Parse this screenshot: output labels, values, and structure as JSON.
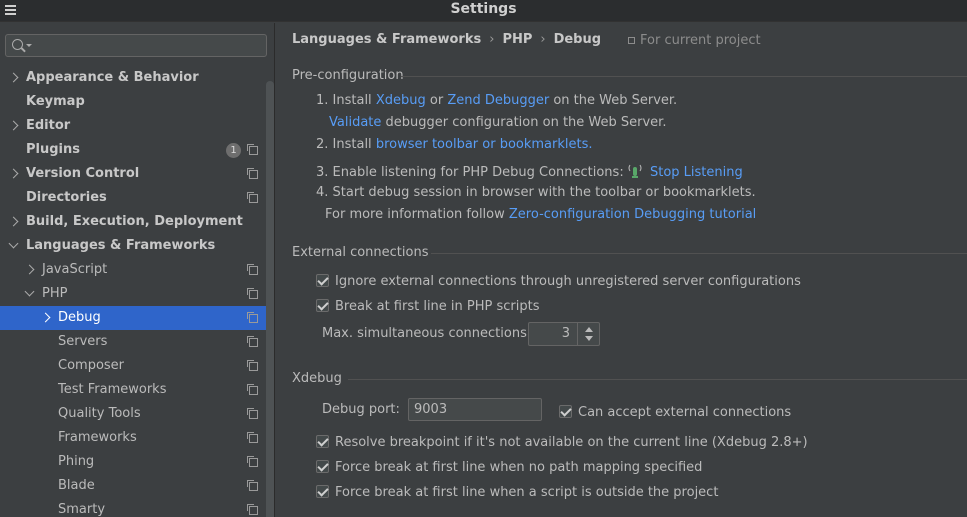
{
  "window": {
    "title": "Settings"
  },
  "search": {
    "placeholder": ""
  },
  "sidebar": {
    "items": [
      {
        "label": "Appearance & Behavior",
        "bold": true,
        "arrow": "collapsed",
        "level": 0,
        "proj": false
      },
      {
        "label": "Keymap",
        "bold": true,
        "arrow": "none",
        "level": 0,
        "proj": false
      },
      {
        "label": "Editor",
        "bold": true,
        "arrow": "collapsed",
        "level": 0,
        "proj": false
      },
      {
        "label": "Plugins",
        "bold": true,
        "arrow": "none",
        "level": 0,
        "proj": true,
        "badge": "1"
      },
      {
        "label": "Version Control",
        "bold": true,
        "arrow": "collapsed",
        "level": 0,
        "proj": true
      },
      {
        "label": "Directories",
        "bold": true,
        "arrow": "none",
        "level": 0,
        "proj": true
      },
      {
        "label": "Build, Execution, Deployment",
        "bold": true,
        "arrow": "collapsed",
        "level": 0,
        "proj": false
      },
      {
        "label": "Languages & Frameworks",
        "bold": true,
        "arrow": "expanded",
        "level": 0,
        "proj": false
      },
      {
        "label": "JavaScript",
        "bold": false,
        "arrow": "collapsed",
        "level": 1,
        "proj": true
      },
      {
        "label": "PHP",
        "bold": false,
        "arrow": "expanded",
        "level": 1,
        "proj": true
      },
      {
        "label": "Debug",
        "bold": false,
        "arrow": "collapsed",
        "level": 2,
        "proj": true,
        "selected": true
      },
      {
        "label": "Servers",
        "bold": false,
        "arrow": "none",
        "level": 2,
        "proj": true
      },
      {
        "label": "Composer",
        "bold": false,
        "arrow": "none",
        "level": 2,
        "proj": true
      },
      {
        "label": "Test Frameworks",
        "bold": false,
        "arrow": "none",
        "level": 2,
        "proj": true
      },
      {
        "label": "Quality Tools",
        "bold": false,
        "arrow": "none",
        "level": 2,
        "proj": true
      },
      {
        "label": "Frameworks",
        "bold": false,
        "arrow": "none",
        "level": 2,
        "proj": true
      },
      {
        "label": "Phing",
        "bold": false,
        "arrow": "none",
        "level": 2,
        "proj": true
      },
      {
        "label": "Blade",
        "bold": false,
        "arrow": "none",
        "level": 2,
        "proj": true
      },
      {
        "label": "Smarty",
        "bold": false,
        "arrow": "none",
        "level": 2,
        "proj": true
      }
    ]
  },
  "breadcrumb": {
    "part1": "Languages & Frameworks",
    "sep": "›",
    "part2": "PHP",
    "part3": "Debug",
    "for_project": "For current project"
  },
  "preconfig": {
    "title": "Pre-configuration",
    "step1_prefix": "1. Install",
    "step1_link1": "Xdebug",
    "step1_or": "or",
    "step1_link2": "Zend Debugger",
    "step1_suffix": "on the Web Server.",
    "validate_link": "Validate",
    "validate_suffix": "debugger configuration on the Web Server.",
    "step2_prefix": "2. Install",
    "step2_link": "browser toolbar or bookmarklets.",
    "step3_prefix": "3. Enable listening for PHP Debug Connections:",
    "step3_link": "Stop Listening",
    "step4": "4. Start debug session in browser with the toolbar or bookmarklets.",
    "more_prefix": "For more information follow",
    "more_link": "Zero-configuration Debugging tutorial"
  },
  "external": {
    "title": "External connections",
    "ignore_label": "Ignore external connections through unregistered server configurations",
    "break_label": "Break at first line in PHP scripts",
    "max_label": "Max. simultaneous connections:",
    "max_value": "3"
  },
  "xdebug": {
    "title": "Xdebug",
    "port_label": "Debug port:",
    "port_value": "9003",
    "accept_label": "Can accept external connections",
    "resolve_label": "Resolve breakpoint if it's not available on the current line (Xdebug 2.8+)",
    "force_nopath_label": "Force break at first line when no path mapping specified",
    "force_outside_label": "Force break at first line when a script is outside the project"
  },
  "colors": {
    "accent": "#2f65ca",
    "link": "#589df6",
    "background": "#3c3f41"
  }
}
